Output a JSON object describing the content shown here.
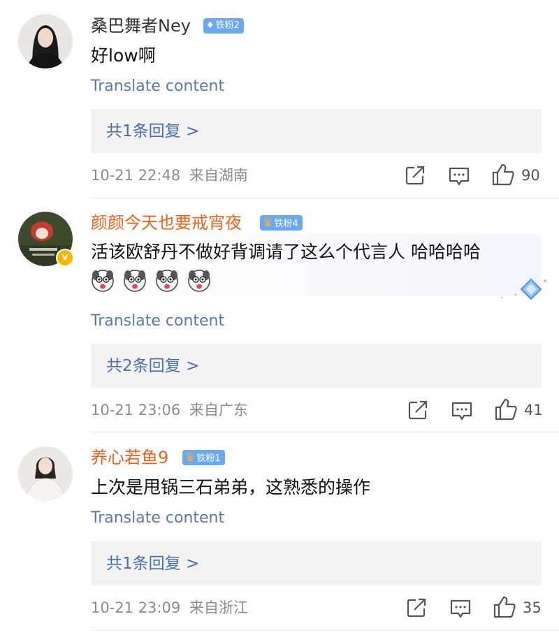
{
  "comments": [
    {
      "username": "桑巴舞者Ney",
      "fan_badge": "铁粉2",
      "text": "好low啊",
      "translate": "Translate content",
      "replies": "共1条回复 >",
      "timestamp": "10-21 22:48",
      "location": "来自湖南",
      "likes": "90"
    },
    {
      "username": "颜颜今天也要戒宵夜",
      "fan_badge": "铁粉4",
      "text": "活该欧舒丹不做好背调请了这么个代言人 哈哈哈哈",
      "translate": "Translate content",
      "replies": "共2条回复 >",
      "timestamp": "10-21 23:06",
      "location": "来自广东",
      "likes": "41"
    },
    {
      "username": "养心若鱼9",
      "fan_badge": "铁粉1",
      "text": "上次是甩锅三石弟弟，这熟悉的操作",
      "translate": "Translate content",
      "replies": "共1条回复 >",
      "timestamp": "10-21 23:09",
      "location": "来自浙江",
      "likes": "35"
    }
  ],
  "colors": {
    "link": "#5b7aa3",
    "vip_name": "#e8631f",
    "badge": "#6aa8ef",
    "reply_bg": "#f2f2f2"
  }
}
